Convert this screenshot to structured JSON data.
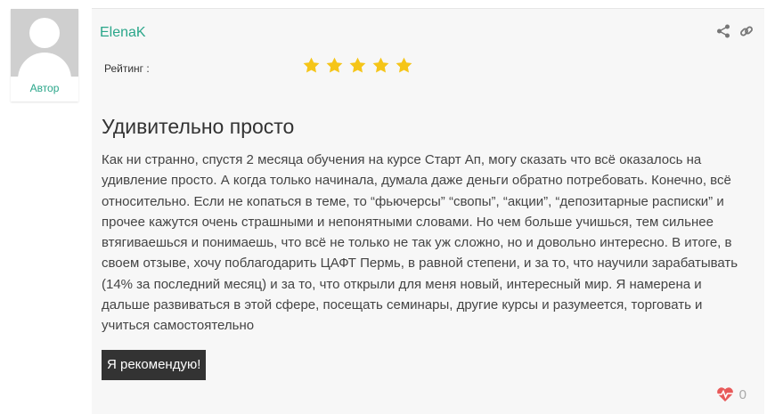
{
  "sidebar": {
    "role_label": "Автор"
  },
  "review": {
    "author": "ElenaK",
    "rating_label": "Рейтинг :",
    "rating": 5,
    "rating_max": 5,
    "title": "Удивительно просто",
    "text": "Как ни странно, спустя 2 месяца обучения на курсе Старт Ап, могу сказать что всё оказалось на удивление просто. А когда только начинала, думала даже деньги обратно потребовать. Конечно, всё относительно. Если не копаться в теме, то “фьючерсы” “свопы”, “акции”, “депозитарные расписки” и прочее кажутся очень страшными и непонятными словами. Но чем больше учишься, тем сильнее втягиваешься и понимаешь, что всё не только не так уж сложно, но и довольно интересно. В итоге, в своем отзыве, хочу поблагодарить ЦАФТ Пермь, в равной степени, и за то, что научили зарабатывать (14% за последний месяц) и за то, что открыли для меня новый, интересный мир. Я намерена и дальше развиваться в этой сфере, посещать семинары, другие курсы и разумеется, торговать и учиться самостоятельно",
    "recommend_label": "Я рекомендую!",
    "likes": "0"
  },
  "icons": {
    "share": "share-icon",
    "link": "link-icon",
    "like": "heart-pulse-icon",
    "star": "star-icon",
    "avatar": "user-avatar-icon"
  },
  "colors": {
    "accent": "#2aa68a",
    "star": "#f5c518",
    "heart": "#e85a5a",
    "button_bg": "#333333",
    "card_bg": "#f7f7f7"
  }
}
